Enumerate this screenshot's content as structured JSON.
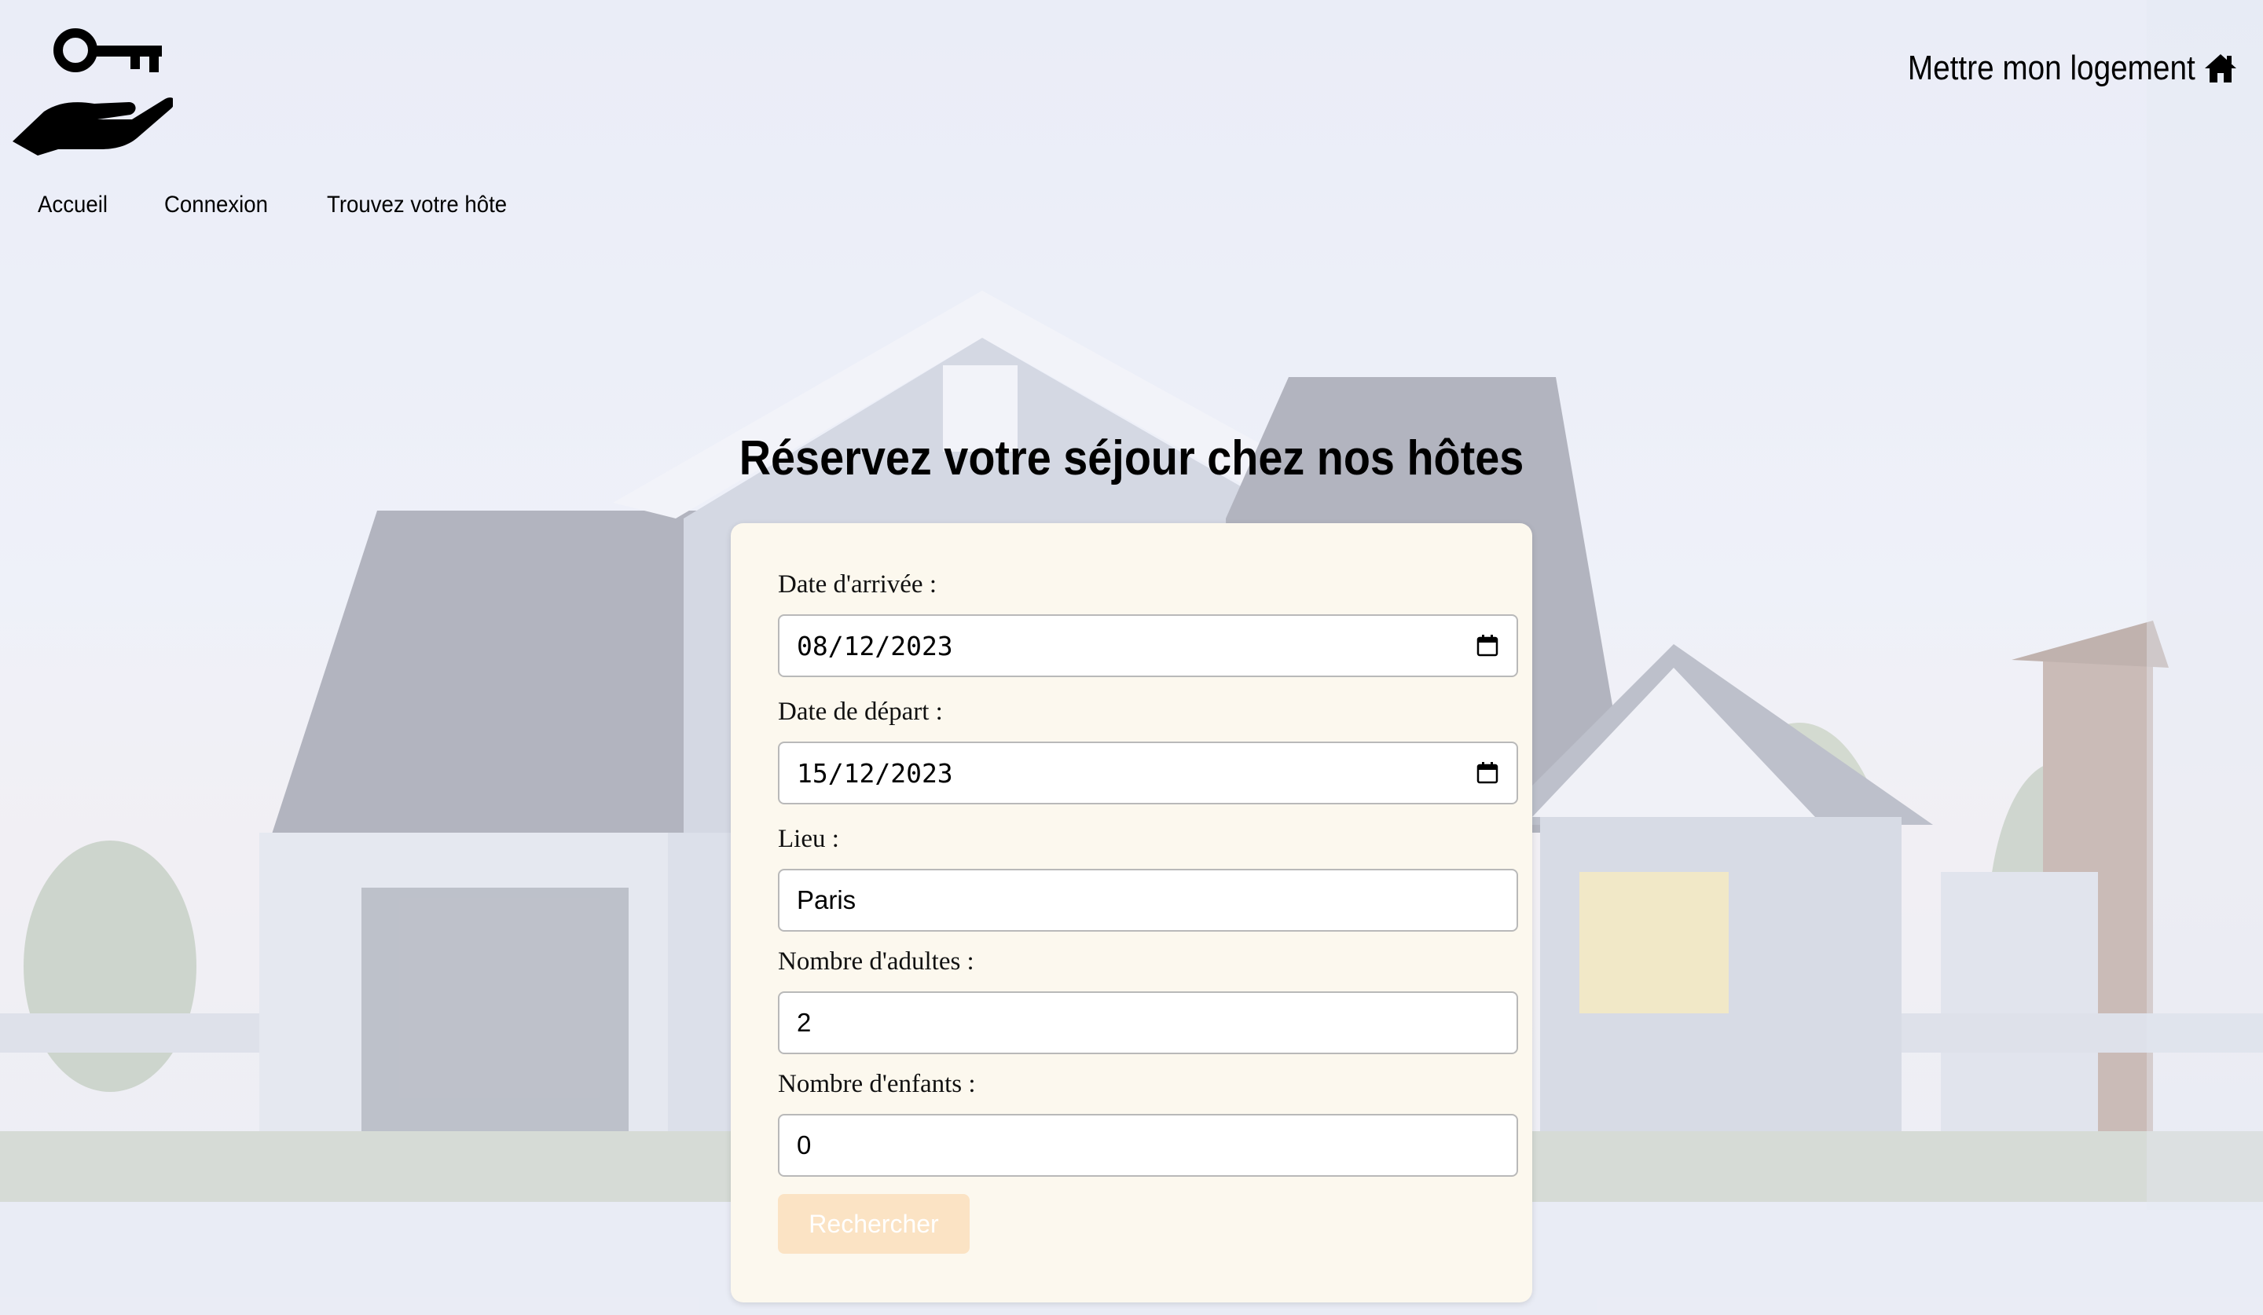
{
  "header": {
    "logo_icon": "key-in-hand-icon",
    "nav": [
      "Accueil",
      "Connexion",
      "Trouvez votre hôte"
    ],
    "host_link_label": "Mettre mon logement",
    "host_link_icon": "house-icon"
  },
  "main": {
    "title": "Réservez votre séjour chez nos hôtes"
  },
  "form": {
    "arrival_label": "Date d'arrivée :",
    "arrival_value": "08/12/2023",
    "departure_label": "Date de départ :",
    "departure_value": "15/12/2023",
    "location_label": "Lieu :",
    "location_value": "Paris",
    "adults_label": "Nombre d'adultes :",
    "adults_value": "2",
    "children_label": "Nombre d'enfants :",
    "children_value": "0",
    "submit_label": "Rechercher",
    "calendar_icon": "calendar-icon"
  },
  "colors": {
    "card_bg": "#fcf8ee",
    "button_bg": "#fbe3c4",
    "button_text": "#ffffff"
  }
}
